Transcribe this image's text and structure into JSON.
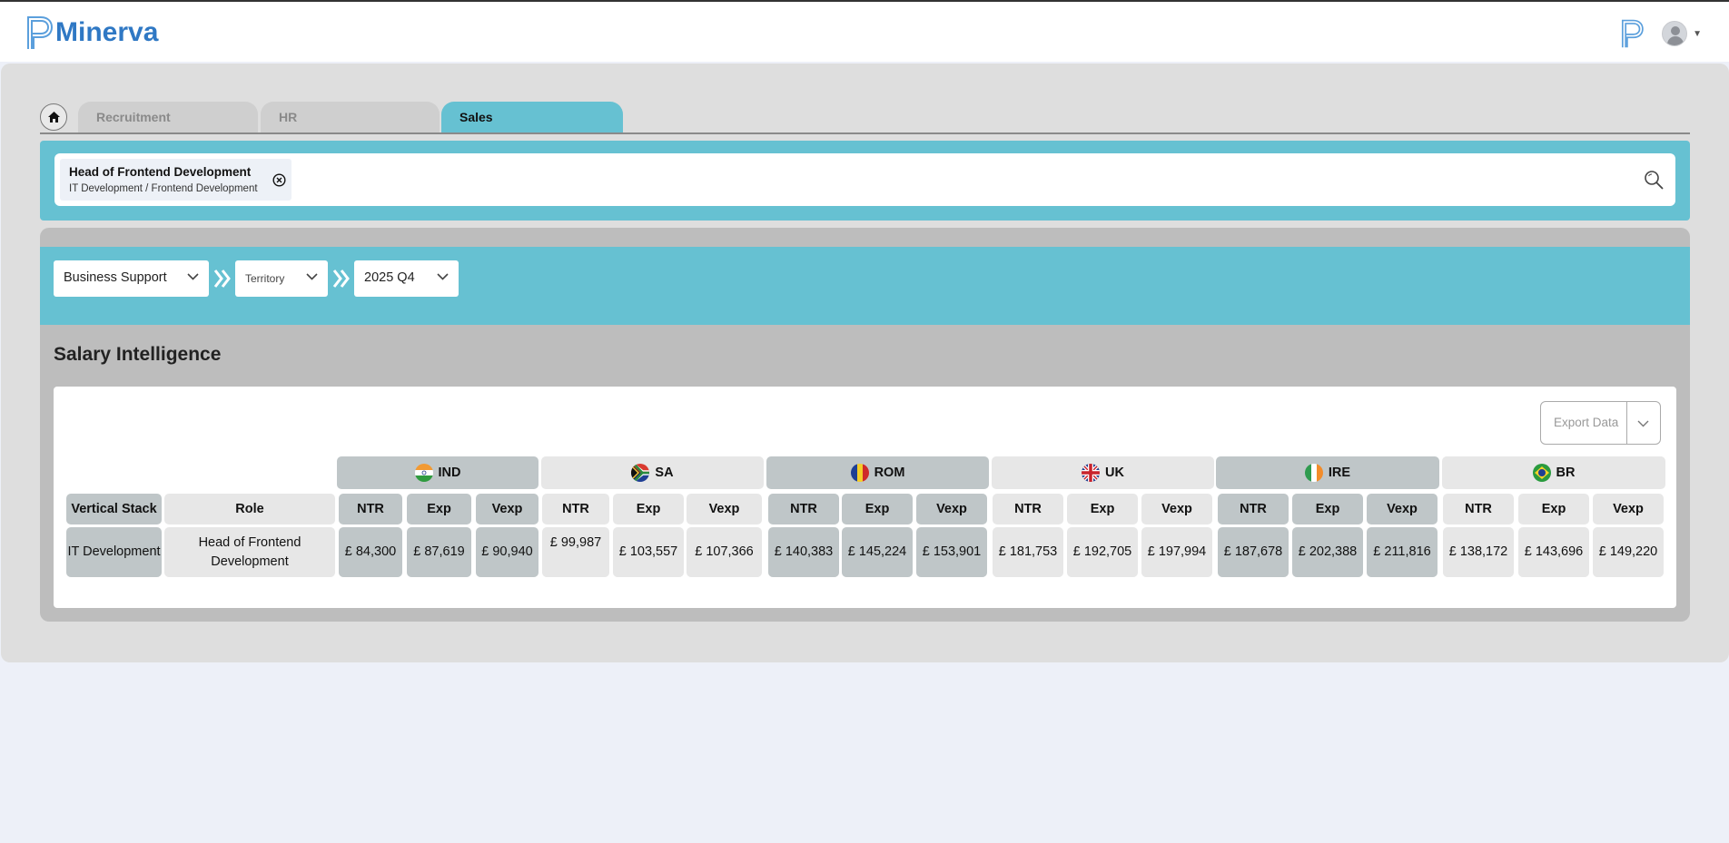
{
  "app": {
    "name": "Minerva"
  },
  "tabs": [
    {
      "label": "Recruitment",
      "active": false
    },
    {
      "label": "HR",
      "active": false
    },
    {
      "label": "Sales",
      "active": true
    }
  ],
  "search": {
    "chip_title": "Head of Frontend Development",
    "chip_subtitle": "IT Development / Frontend Development"
  },
  "filters": {
    "business": "Business Support",
    "territory": "Territory",
    "period": "2025 Q4"
  },
  "section": {
    "title": "Salary Intelligence"
  },
  "export": {
    "label": "Export Data"
  },
  "table": {
    "col_vertical": "Vertical Stack",
    "col_role": "Role",
    "row_vertical": "IT Development",
    "row_role": "Head of Frontend Development",
    "countries": [
      {
        "name": "IND",
        "flag": "india-flag-icon",
        "shade": "dark",
        "metrics": [
          "NTR",
          "Exp",
          "Vexp"
        ],
        "values": [
          "£ 84,300",
          "£ 87,619",
          "£ 90,940"
        ]
      },
      {
        "name": "SA",
        "flag": "south-africa-flag-icon",
        "shade": "light",
        "metrics": [
          "NTR",
          "Exp",
          "Vexp"
        ],
        "values": [
          "£ 99,987",
          "£ 103,557",
          "£ 107,366"
        ]
      },
      {
        "name": "ROM",
        "flag": "romania-flag-icon",
        "shade": "dark",
        "metrics": [
          "NTR",
          "Exp",
          "Vexp"
        ],
        "values": [
          "£ 140,383",
          "£ 145,224",
          "£ 153,901"
        ]
      },
      {
        "name": "UK",
        "flag": "uk-flag-icon",
        "shade": "light",
        "metrics": [
          "NTR",
          "Exp",
          "Vexp"
        ],
        "values": [
          "£ 181,753",
          "£ 192,705",
          "£ 197,994"
        ]
      },
      {
        "name": "IRE",
        "flag": "ireland-flag-icon",
        "shade": "dark",
        "metrics": [
          "NTR",
          "Exp",
          "Vexp"
        ],
        "values": [
          "£ 187,678",
          "£ 202,388",
          "£ 211,816"
        ]
      },
      {
        "name": "BR",
        "flag": "brazil-flag-icon",
        "shade": "light",
        "metrics": [
          "NTR",
          "Exp",
          "Vexp"
        ],
        "values": [
          "£ 138,172",
          "£ 143,696",
          "£ 149,220"
        ]
      }
    ]
  },
  "colors": {
    "accent": "#66c1d2",
    "brand": "#2f78c4",
    "dark_cell": "#bfc6c8",
    "light_cell": "#e7e7e7"
  }
}
